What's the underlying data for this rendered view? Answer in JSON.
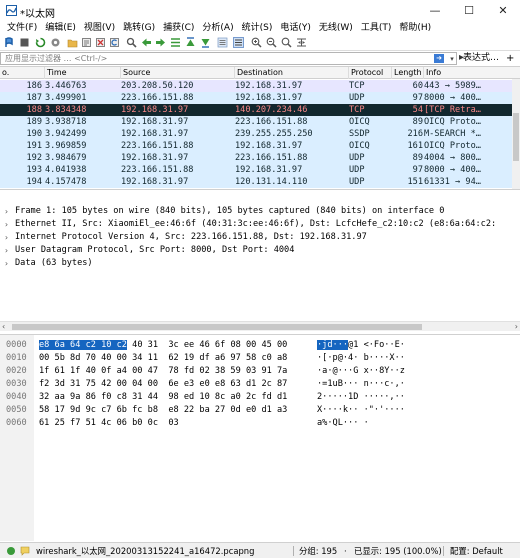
{
  "window": {
    "title": "*以太网",
    "minimize": "—",
    "maximize": "☐",
    "close": "✕"
  },
  "menu": [
    "文件(F)",
    "编辑(E)",
    "视图(V)",
    "跳转(G)",
    "捕获(C)",
    "分析(A)",
    "统计(S)",
    "电话(Y)",
    "无线(W)",
    "工具(T)",
    "帮助(H)"
  ],
  "filter": {
    "placeholder": "应用显示过滤器 … <Ctrl-/>",
    "expression_label": "表达式…",
    "add_label": "+"
  },
  "packet_list": {
    "columns": [
      "o.",
      "Time",
      "Source",
      "Destination",
      "Protocol",
      "Length",
      "Info"
    ],
    "rows": [
      {
        "no": "186",
        "time": "3.446763",
        "src": "203.208.50.120",
        "dst": "192.168.31.97",
        "proto": "TCP",
        "len": "60",
        "info": "443 → 5989…",
        "style": "tcp"
      },
      {
        "no": "187",
        "time": "3.499901",
        "src": "223.166.151.88",
        "dst": "192.168.31.97",
        "proto": "UDP",
        "len": "97",
        "info": "8000 → 400…",
        "style": "udp"
      },
      {
        "no": "188",
        "time": "3.834348",
        "src": "192.168.31.97",
        "dst": "140.207.234.46",
        "proto": "TCP",
        "len": "54",
        "info": "[TCP Retra…",
        "style": "selected"
      },
      {
        "no": "189",
        "time": "3.938718",
        "src": "192.168.31.97",
        "dst": "223.166.151.88",
        "proto": "OICQ",
        "len": "89",
        "info": "OICQ Proto…",
        "style": "udp"
      },
      {
        "no": "190",
        "time": "3.942499",
        "src": "192.168.31.97",
        "dst": "239.255.255.250",
        "proto": "SSDP",
        "len": "216",
        "info": "M-SEARCH *…",
        "style": "udp"
      },
      {
        "no": "191",
        "time": "3.969859",
        "src": "223.166.151.88",
        "dst": "192.168.31.97",
        "proto": "OICQ",
        "len": "161",
        "info": "OICQ Proto…",
        "style": "udp"
      },
      {
        "no": "192",
        "time": "3.984679",
        "src": "192.168.31.97",
        "dst": "223.166.151.88",
        "proto": "UDP",
        "len": "89",
        "info": "4004 → 800…",
        "style": "udp"
      },
      {
        "no": "193",
        "time": "4.041938",
        "src": "223.166.151.88",
        "dst": "192.168.31.97",
        "proto": "UDP",
        "len": "97",
        "info": "8000 → 400…",
        "style": "udp"
      },
      {
        "no": "194",
        "time": "4.157478",
        "src": "192.168.31.97",
        "dst": "120.131.14.110",
        "proto": "UDP",
        "len": "151",
        "info": "61331 → 94…",
        "style": "udp"
      }
    ]
  },
  "details": [
    "Frame 1: 105 bytes on wire (840 bits), 105 bytes captured (840 bits) on interface 0",
    "Ethernet II, Src: XiaomiEl_ee:46:6f (40:31:3c:ee:46:6f), Dst: LcfcHefe_c2:10:c2 (e8:6a:64:c2:",
    "Internet Protocol Version 4, Src: 223.166.151.88, Dst: 192.168.31.97",
    "User Datagram Protocol, Src Port: 8000, Dst Port: 4004",
    "Data (63 bytes)"
  ],
  "bytes": [
    {
      "off": "0000",
      "hex_sel": "e8 6a 64 c2 10 c2",
      "hex": " 40 31  3c ee 46 6f 08 00 45 00",
      "asc_sel": "·jd···",
      "asc": "@1 <·Fo··E·"
    },
    {
      "off": "0010",
      "hex_sel": "",
      "hex": "00 5b 8d 70 40 00 34 11  62 19 df a6 97 58 c0 a8",
      "asc_sel": "",
      "asc": "·[·p@·4· b····X··"
    },
    {
      "off": "0020",
      "hex_sel": "",
      "hex": "1f 61 1f 40 0f a4 00 47  78 fd 02 38 59 03 91 7a",
      "asc_sel": "",
      "asc": "·a·@···G x··8Y··z"
    },
    {
      "off": "0030",
      "hex_sel": "",
      "hex": "f2 3d 31 75 42 00 04 00  6e e3 e0 e8 63 d1 2c 87",
      "asc_sel": "",
      "asc": "·=1uB··· n···c·,·"
    },
    {
      "off": "0040",
      "hex_sel": "",
      "hex": "32 aa 9a 86 f0 c8 31 44  98 ed 10 8c a0 2c fd d1",
      "asc_sel": "",
      "asc": "2·····1D ·····,··"
    },
    {
      "off": "0050",
      "hex_sel": "",
      "hex": "58 17 9d 9c c7 6b fc b8  e8 22 ba 27 0d e0 d1 a3",
      "asc_sel": "",
      "asc": "X····k·· ·\"·'····"
    },
    {
      "off": "0060",
      "hex_sel": "",
      "hex": "61 25 f7 51 4c 06 b0 0c  03",
      "asc_sel": "",
      "asc": "a%·QL··· ·"
    }
  ],
  "status": {
    "file": "wireshark_以太网_20200313152241_a16472.pcapng",
    "groups": "分组: 195",
    "displayed": "已显示: 195 (100.0%)",
    "profile": "配置: Default"
  },
  "colors": {
    "tcp_row": "#e7e6ff",
    "udp_row": "#daeeff",
    "selected_row": "#12272e",
    "selected_text": "#f78787",
    "byte_highlight": "#1565c0"
  }
}
